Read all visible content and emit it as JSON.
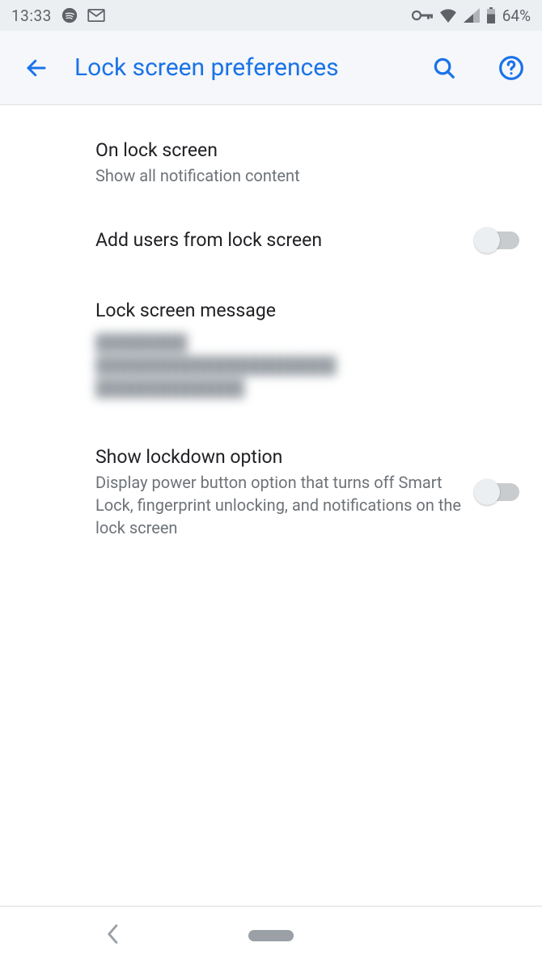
{
  "status": {
    "time": "13:33",
    "battery": "64%"
  },
  "header": {
    "title": "Lock screen preferences"
  },
  "settings": {
    "onLockScreen": {
      "title": "On lock screen",
      "sub": "Show all notification content"
    },
    "addUsers": {
      "title": "Add users from lock screen",
      "enabled": false
    },
    "lockMessage": {
      "title": "Lock screen message",
      "blurred_line1": "████████",
      "blurred_line2": "█████████████████████",
      "blurred_line3": "█████████████"
    },
    "lockdown": {
      "title": "Show lockdown option",
      "sub": "Display power button option that turns off Smart Lock, fingerprint unlocking, and notifications on the lock screen",
      "enabled": false
    }
  }
}
